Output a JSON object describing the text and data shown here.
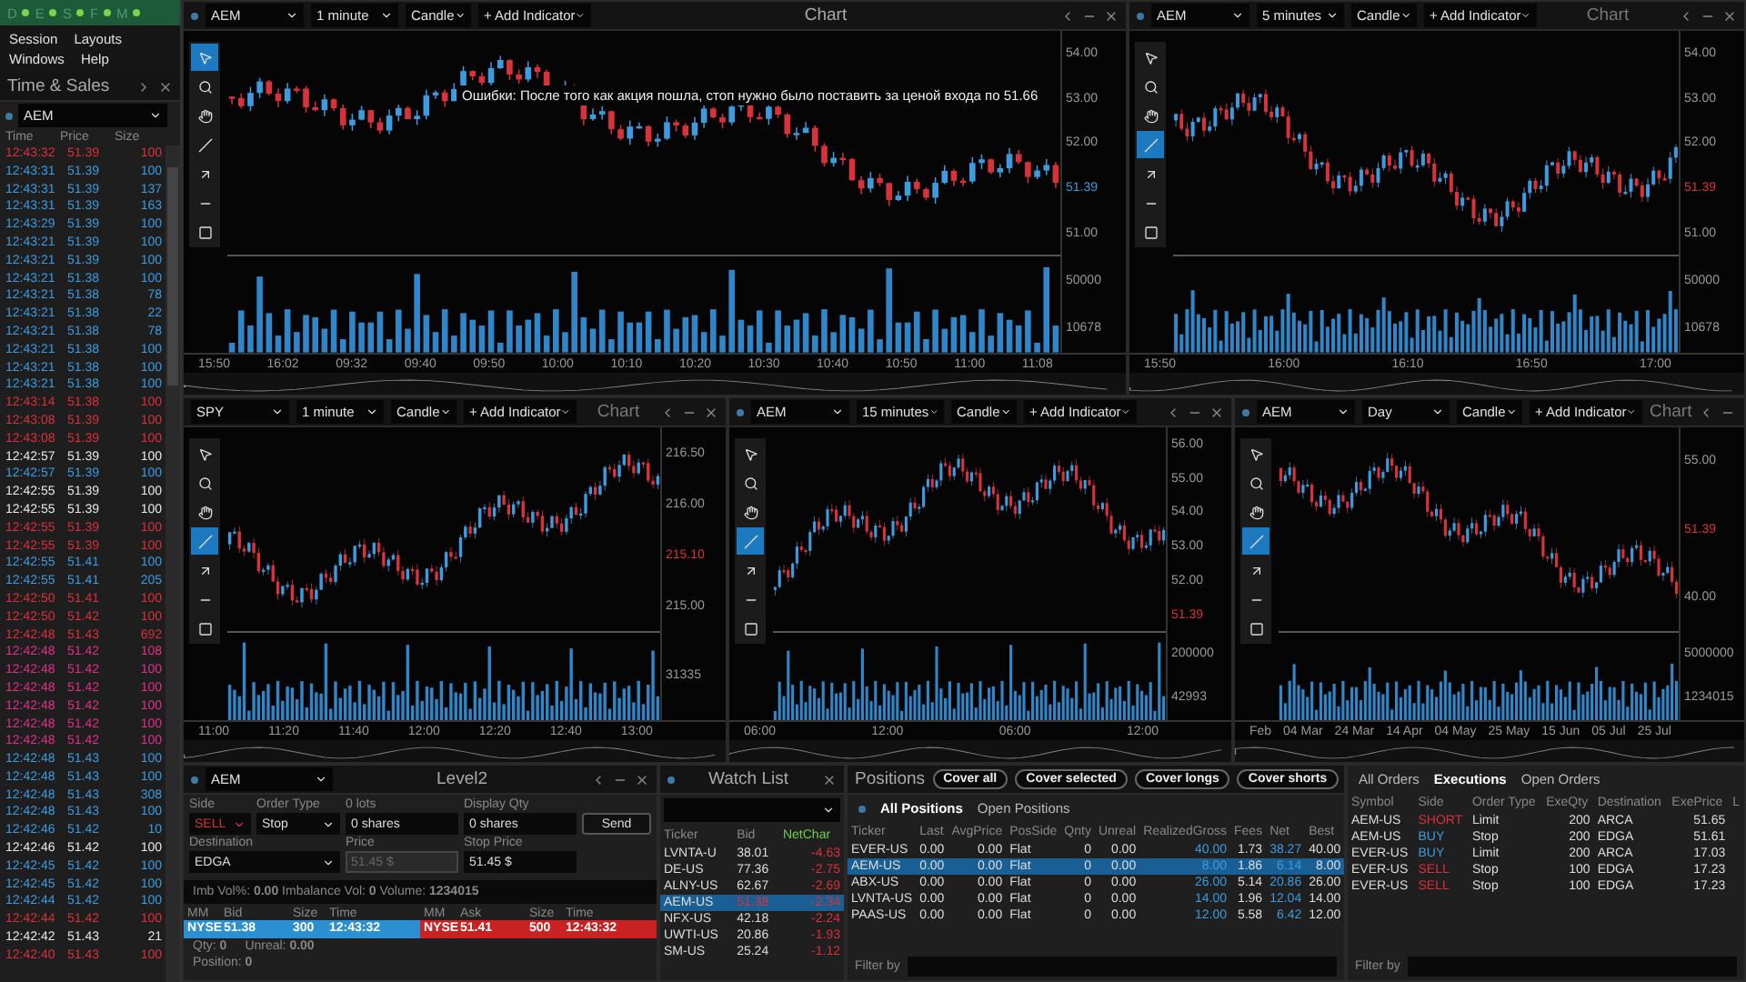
{
  "app_bar": {
    "letters": [
      "D",
      "E",
      "S",
      "F",
      "M"
    ]
  },
  "menu": [
    "Session",
    "Layouts",
    "Windows",
    "Help"
  ],
  "time_sales": {
    "title": "Time & Sales",
    "symbol": "AEM",
    "columns": [
      "Time",
      "Price",
      "Size"
    ],
    "rows": [
      {
        "time": "12:43:32",
        "price": "51.39",
        "size": "100",
        "color": "#d8323a"
      },
      {
        "time": "12:43:31",
        "price": "51.39",
        "size": "100",
        "color": "#3d9be0"
      },
      {
        "time": "12:43:31",
        "price": "51.39",
        "size": "137",
        "color": "#3d9be0"
      },
      {
        "time": "12:43:31",
        "price": "51.39",
        "size": "163",
        "color": "#3d9be0"
      },
      {
        "time": "12:43:29",
        "price": "51.39",
        "size": "100",
        "color": "#3d9be0"
      },
      {
        "time": "12:43:21",
        "price": "51.39",
        "size": "100",
        "color": "#3d9be0"
      },
      {
        "time": "12:43:21",
        "price": "51.39",
        "size": "100",
        "color": "#3d9be0"
      },
      {
        "time": "12:43:21",
        "price": "51.38",
        "size": "100",
        "color": "#3d9be0"
      },
      {
        "time": "12:43:21",
        "price": "51.38",
        "size": "78",
        "color": "#3d9be0"
      },
      {
        "time": "12:43:21",
        "price": "51.38",
        "size": "22",
        "color": "#3d9be0"
      },
      {
        "time": "12:43:21",
        "price": "51.38",
        "size": "78",
        "color": "#3d9be0"
      },
      {
        "time": "12:43:21",
        "price": "51.38",
        "size": "100",
        "color": "#3d9be0"
      },
      {
        "time": "12:43:21",
        "price": "51.38",
        "size": "100",
        "color": "#3d9be0"
      },
      {
        "time": "12:43:21",
        "price": "51.38",
        "size": "100",
        "color": "#3d9be0"
      },
      {
        "time": "12:43:14",
        "price": "51.38",
        "size": "100",
        "color": "#d8323a"
      },
      {
        "time": "12:43:08",
        "price": "51.39",
        "size": "100",
        "color": "#d8323a"
      },
      {
        "time": "12:43:08",
        "price": "51.39",
        "size": "100",
        "color": "#d8323a"
      },
      {
        "time": "12:42:57",
        "price": "51.39",
        "size": "100",
        "color": "#e8e8e8"
      },
      {
        "time": "12:42:57",
        "price": "51.39",
        "size": "100",
        "color": "#3d9be0"
      },
      {
        "time": "12:42:55",
        "price": "51.39",
        "size": "100",
        "color": "#e8e8e8"
      },
      {
        "time": "12:42:55",
        "price": "51.39",
        "size": "100",
        "color": "#e8e8e8"
      },
      {
        "time": "12:42:55",
        "price": "51.39",
        "size": "100",
        "color": "#d8323a"
      },
      {
        "time": "12:42:55",
        "price": "51.39",
        "size": "100",
        "color": "#d8323a"
      },
      {
        "time": "12:42:55",
        "price": "51.41",
        "size": "100",
        "color": "#3d9be0"
      },
      {
        "time": "12:42:55",
        "price": "51.41",
        "size": "205",
        "color": "#3d9be0"
      },
      {
        "time": "12:42:50",
        "price": "51.41",
        "size": "100",
        "color": "#d8323a"
      },
      {
        "time": "12:42:50",
        "price": "51.42",
        "size": "100",
        "color": "#d8323a"
      },
      {
        "time": "12:42:48",
        "price": "51.43",
        "size": "692",
        "color": "#d8323a"
      },
      {
        "time": "12:42:48",
        "price": "51.42",
        "size": "108",
        "color": "#e0308a"
      },
      {
        "time": "12:42:48",
        "price": "51.42",
        "size": "100",
        "color": "#e0308a"
      },
      {
        "time": "12:42:48",
        "price": "51.42",
        "size": "100",
        "color": "#e0308a"
      },
      {
        "time": "12:42:48",
        "price": "51.42",
        "size": "100",
        "color": "#e0308a"
      },
      {
        "time": "12:42:48",
        "price": "51.42",
        "size": "100",
        "color": "#e0308a"
      },
      {
        "time": "12:42:48",
        "price": "51.42",
        "size": "100",
        "color": "#e0308a"
      },
      {
        "time": "12:42:48",
        "price": "51.43",
        "size": "100",
        "color": "#3d9be0"
      },
      {
        "time": "12:42:48",
        "price": "51.43",
        "size": "100",
        "color": "#3d9be0"
      },
      {
        "time": "12:42:48",
        "price": "51.43",
        "size": "308",
        "color": "#3d9be0"
      },
      {
        "time": "12:42:48",
        "price": "51.43",
        "size": "100",
        "color": "#3d9be0"
      },
      {
        "time": "12:42:46",
        "price": "51.42",
        "size": "10",
        "color": "#3d9be0"
      },
      {
        "time": "12:42:46",
        "price": "51.42",
        "size": "100",
        "color": "#e8e8e8"
      },
      {
        "time": "12:42:45",
        "price": "51.42",
        "size": "100",
        "color": "#3d9be0"
      },
      {
        "time": "12:42:45",
        "price": "51.42",
        "size": "100",
        "color": "#3d9be0"
      },
      {
        "time": "12:42:44",
        "price": "51.42",
        "size": "100",
        "color": "#3d9be0"
      },
      {
        "time": "12:42:44",
        "price": "51.42",
        "size": "100",
        "color": "#d8323a"
      },
      {
        "time": "12:42:42",
        "price": "51.43",
        "size": "21",
        "color": "#e8e8e8"
      },
      {
        "time": "12:42:40",
        "price": "51.43",
        "size": "100",
        "color": "#d8323a"
      }
    ]
  },
  "charts": [
    {
      "symbol": "AEM",
      "symbol_dot": true,
      "interval": "1 minute",
      "chart_type": "Candle",
      "add_indicator": "+ Add Indicator",
      "title": "Chart",
      "annotation": "Ошибки: После того как акция пошла, стоп нужно было поставить за ценой входа по 51.66",
      "tools": [
        {
          "kind": "pointer",
          "selected": true
        },
        {
          "kind": "zoom",
          "selected": false
        },
        {
          "kind": "hand",
          "selected": false
        },
        {
          "kind": "line",
          "selected": false
        },
        {
          "kind": "arrow",
          "selected": false
        },
        {
          "kind": "hline",
          "selected": false
        },
        {
          "kind": "rect",
          "selected": false
        }
      ],
      "y_labels": [
        {
          "text": "54.00",
          "kind": "tick"
        },
        {
          "text": "53.00",
          "kind": "tick"
        },
        {
          "text": "52.00",
          "kind": "tick"
        },
        {
          "text": "51.39",
          "kind": "last",
          "color": "#3d9be0"
        },
        {
          "text": "51.00",
          "kind": "tick"
        }
      ],
      "volume_labels": [
        "50000",
        "10678"
      ],
      "x_labels": [
        "15:50",
        "16:02",
        "09:32",
        "09:40",
        "09:50",
        "10:00",
        "10:10",
        "10:20",
        "10:30",
        "10:40",
        "10:50",
        "11:00",
        "11:08"
      ]
    },
    {
      "symbol": "AEM",
      "symbol_dot": true,
      "interval": "5 minutes",
      "chart_type": "Candle",
      "add_indicator": "+ Add Indicator",
      "title": "Chart",
      "tools": [
        {
          "kind": "pointer",
          "selected": false
        },
        {
          "kind": "zoom",
          "selected": false
        },
        {
          "kind": "hand",
          "selected": false
        },
        {
          "kind": "line",
          "selected": true
        },
        {
          "kind": "arrow",
          "selected": false
        },
        {
          "kind": "hline",
          "selected": false
        },
        {
          "kind": "rect",
          "selected": false
        }
      ],
      "y_labels": [
        {
          "text": "54.00",
          "kind": "tick"
        },
        {
          "text": "53.00",
          "kind": "tick"
        },
        {
          "text": "52.00",
          "kind": "tick"
        },
        {
          "text": "51.39",
          "kind": "last",
          "color": "#d8323a"
        },
        {
          "text": "51.00",
          "kind": "tick"
        }
      ],
      "volume_labels": [
        "50000",
        "10678"
      ],
      "x_labels": [
        "15:50",
        "16:00",
        "16:10",
        "16:50",
        "17:00"
      ]
    },
    {
      "symbol": "SPY",
      "symbol_dot": false,
      "interval": "1 minute",
      "chart_type": "Candle",
      "add_indicator": "+ Add Indicator",
      "title": "Chart",
      "tools": [
        {
          "kind": "pointer",
          "selected": false
        },
        {
          "kind": "zoom",
          "selected": false
        },
        {
          "kind": "hand",
          "selected": false
        },
        {
          "kind": "line",
          "selected": true
        },
        {
          "kind": "arrow",
          "selected": false
        },
        {
          "kind": "hline",
          "selected": false
        },
        {
          "kind": "rect",
          "selected": false
        }
      ],
      "y_labels": [
        {
          "text": "216.50",
          "kind": "tick"
        },
        {
          "text": "216.00",
          "kind": "tick"
        },
        {
          "text": "215.10",
          "kind": "last",
          "color": "#d8323a"
        },
        {
          "text": "215.00",
          "kind": "tick"
        }
      ],
      "volume_labels": [
        "31335"
      ],
      "x_labels": [
        "11:00",
        "11:20",
        "11:40",
        "12:00",
        "12:20",
        "12:40",
        "13:00"
      ]
    },
    {
      "symbol": "AEM",
      "symbol_dot": true,
      "interval": "15 minutes",
      "chart_type": "Candle",
      "add_indicator": "+ Add Indicator",
      "tools": [
        {
          "kind": "pointer",
          "selected": false
        },
        {
          "kind": "zoom",
          "selected": false
        },
        {
          "kind": "hand",
          "selected": false
        },
        {
          "kind": "line",
          "selected": true
        },
        {
          "kind": "arrow",
          "selected": false
        },
        {
          "kind": "hline",
          "selected": false
        },
        {
          "kind": "rect",
          "selected": false
        }
      ],
      "y_labels": [
        {
          "text": "56.00",
          "kind": "tick"
        },
        {
          "text": "55.00",
          "kind": "tick"
        },
        {
          "text": "54.00",
          "kind": "tick"
        },
        {
          "text": "53.00",
          "kind": "tick"
        },
        {
          "text": "52.00",
          "kind": "tick"
        },
        {
          "text": "51.39",
          "kind": "last",
          "color": "#d8323a"
        }
      ],
      "volume_labels": [
        "200000",
        "42993"
      ],
      "x_labels": [
        "06:00",
        "12:00",
        "06:00",
        "12:00"
      ]
    },
    {
      "symbol": "AEM",
      "symbol_dot": true,
      "interval": "Day",
      "chart_type": "Candle",
      "add_indicator": "+ Add Indicator",
      "title": "Chart",
      "tools": [
        {
          "kind": "pointer",
          "selected": false
        },
        {
          "kind": "zoom",
          "selected": false
        },
        {
          "kind": "hand",
          "selected": false
        },
        {
          "kind": "line",
          "selected": true
        },
        {
          "kind": "arrow",
          "selected": false
        },
        {
          "kind": "hline",
          "selected": false
        },
        {
          "kind": "rect",
          "selected": false
        }
      ],
      "y_labels": [
        {
          "text": "55.00",
          "kind": "tick"
        },
        {
          "text": "51.39",
          "kind": "last",
          "color": "#d8323a"
        },
        {
          "text": "40.00",
          "kind": "tick"
        }
      ],
      "volume_labels": [
        "5000000",
        "1234015"
      ],
      "x_labels": [
        "Feb",
        "04 Mar",
        "24 Mar",
        "14 Apr",
        "04 May",
        "25 May",
        "15 Jun",
        "05 Jul",
        "25 Jul"
      ]
    }
  ],
  "level2": {
    "symbol": "AEM",
    "title": "Level2",
    "side_label": "Side",
    "side": "SELL",
    "order_type_label": "Order Type",
    "order_type": "Stop",
    "lots_label": "0 lots",
    "shares": "0 shares",
    "display_qty_label": "Display Qty",
    "display_qty": "0 shares",
    "send": "Send",
    "destination_label": "Destination",
    "destination": "EDGA",
    "price_label": "Price",
    "price": "51.45 $",
    "stop_price_label": "Stop Price",
    "stop_price": "51.45 $",
    "info": "Imb Vol%: **0.00**  Imbalance Vol: **0**  Volume: **1234015**",
    "bid_columns": [
      "MM",
      "Bid",
      "Size",
      "Time"
    ],
    "ask_columns": [
      "MM",
      "Ask",
      "Size",
      "Time"
    ],
    "bid": [
      "NYSE",
      "51.38",
      "300",
      "12:43:32"
    ],
    "ask": [
      "NYSE",
      "51.41",
      "500",
      "12:43:32"
    ],
    "qty": "Qty: **0**",
    "unreal": "Unreal: **0.00**",
    "position": "Position: **0**"
  },
  "watch_list": {
    "title": "Watch List",
    "columns": [
      "Ticker",
      "Bid",
      "NetChar"
    ],
    "rows": [
      {
        "ticker": "LVNTA-U",
        "bid": "38.01",
        "change": "-4.63",
        "selected": false
      },
      {
        "ticker": "DE-US",
        "bid": "77.36",
        "change": "-2.75",
        "selected": false
      },
      {
        "ticker": "ALNY-US",
        "bid": "62.67",
        "change": "-2.69",
        "selected": false
      },
      {
        "ticker": "AEM-US",
        "bid": "51.38",
        "change": "-2.34",
        "selected": true
      },
      {
        "ticker": "NFX-US",
        "bid": "42.18",
        "change": "-2.24",
        "selected": false
      },
      {
        "ticker": "UWTI-US",
        "bid": "20.86",
        "change": "-1.93",
        "selected": false
      },
      {
        "ticker": "SM-US",
        "bid": "25.24",
        "change": "-1.12",
        "selected": false
      }
    ]
  },
  "positions": {
    "title": "Positions",
    "buttons": [
      "Cover all",
      "Cover selected",
      "Cover longs",
      "Cover shorts"
    ],
    "tabs": [
      {
        "label": "All Positions",
        "selected": true
      },
      {
        "label": "Open Positions",
        "selected": false
      }
    ],
    "columns": [
      "Ticker",
      "Last",
      "AvgPrice",
      "PosSide",
      "Qnty",
      "Unreal",
      "RealizedGross",
      "Fees",
      "Net",
      "Best"
    ],
    "rows": [
      {
        "cells": [
          "EVER-US",
          "0.00",
          "0.00",
          "Flat",
          "0",
          "0.00",
          "40.00",
          "1.73",
          "38.27",
          "40.00"
        ],
        "selected": false
      },
      {
        "cells": [
          "AEM-US",
          "0.00",
          "0.00",
          "Flat",
          "0",
          "0.00",
          "8.00",
          "1.86",
          "6.14",
          "8.00"
        ],
        "selected": true
      },
      {
        "cells": [
          "ABX-US",
          "0.00",
          "0.00",
          "Flat",
          "0",
          "0.00",
          "26.00",
          "5.14",
          "20.86",
          "26.00"
        ],
        "selected": false
      },
      {
        "cells": [
          "LVNTA-US",
          "0.00",
          "0.00",
          "Flat",
          "0",
          "0.00",
          "14.00",
          "1.96",
          "12.04",
          "14.00"
        ],
        "selected": false
      },
      {
        "cells": [
          "PAAS-US",
          "0.00",
          "0.00",
          "Flat",
          "0",
          "0.00",
          "12.00",
          "5.58",
          "6.42",
          "12.00"
        ],
        "selected": false
      }
    ],
    "filter_label": "Filter by"
  },
  "orders": {
    "tabs": [
      {
        "label": "All Orders",
        "selected": false
      },
      {
        "label": "Executions",
        "selected": true
      },
      {
        "label": "Open Orders",
        "selected": false
      }
    ],
    "columns": [
      "Symbol",
      "Side",
      "Order Type",
      "ExeQty",
      "Destination",
      "ExePrice",
      "L"
    ],
    "rows": [
      {
        "symbol": "AEM-US",
        "side": "SHORT",
        "color": "#d8323a",
        "type": "Limit",
        "qty": "200",
        "destination": "ARCA",
        "price": "51.65"
      },
      {
        "symbol": "AEM-US",
        "side": "BUY",
        "color": "#3d9be0",
        "type": "Stop",
        "qty": "200",
        "destination": "EDGA",
        "price": "51.61"
      },
      {
        "symbol": "EVER-US",
        "side": "BUY",
        "color": "#3d9be0",
        "type": "Limit",
        "qty": "200",
        "destination": "ARCA",
        "price": "17.03"
      },
      {
        "symbol": "EVER-US",
        "side": "SELL",
        "color": "#d8323a",
        "type": "Stop",
        "qty": "100",
        "destination": "EDGA",
        "price": "17.23"
      },
      {
        "symbol": "EVER-US",
        "side": "SELL",
        "color": "#d8323a",
        "type": "Stop",
        "qty": "100",
        "destination": "EDGA",
        "price": "17.23"
      }
    ],
    "filter_label": "Filter by"
  }
}
